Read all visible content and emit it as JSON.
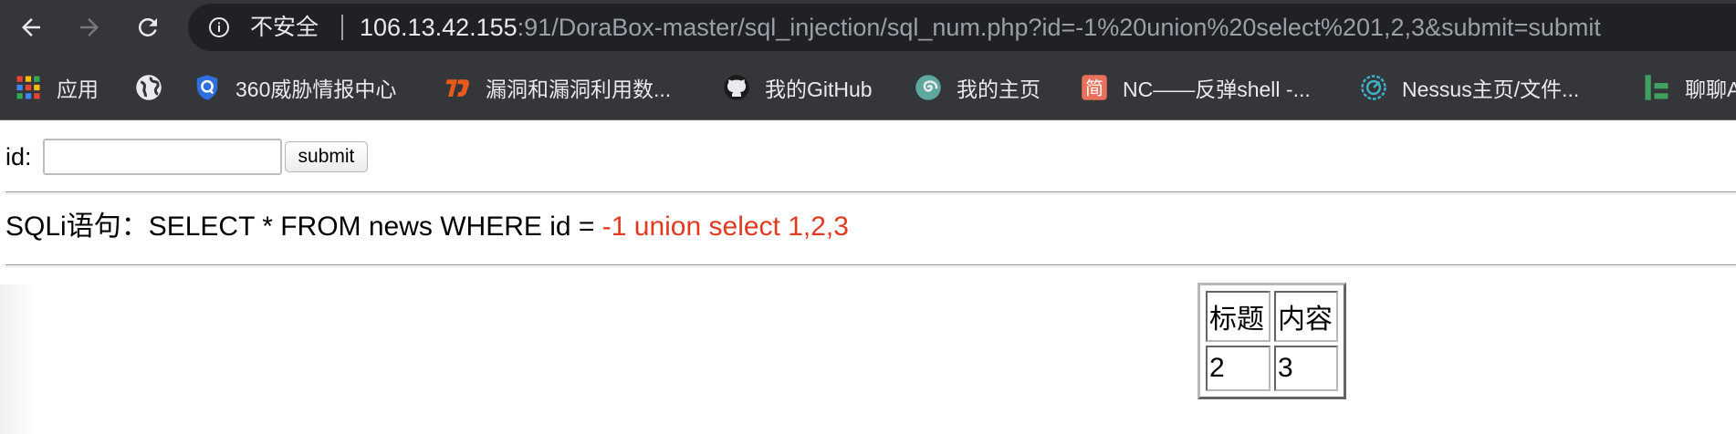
{
  "browser": {
    "back_icon": "arrow-left-icon",
    "forward_icon": "arrow-right-icon",
    "reload_icon": "reload-icon",
    "info_icon": "info-icon",
    "security_label": "不安全",
    "url_host": "106.13.42.155",
    "url_rest": ":91/DoraBox-master/sql_injection/sql_num.php?id=-1%20union%20select%201,2,3&submit=submit"
  },
  "bookmarks": [
    {
      "label": "应用",
      "icon": "apps-grid-icon"
    },
    {
      "label": "",
      "icon": "globe-icon"
    },
    {
      "label": "360威胁情报中心",
      "icon": "360-shield-icon"
    },
    {
      "label": "漏洞和漏洞利用数...",
      "icon": "exploit-db-icon"
    },
    {
      "label": "我的GitHub",
      "icon": "github-icon"
    },
    {
      "label": "我的主页",
      "icon": "spiral-icon"
    },
    {
      "label": "NC——反弹shell -...",
      "icon": "jianshu-icon"
    },
    {
      "label": "Nessus主页/文件...",
      "icon": "nessus-icon"
    },
    {
      "label": "聊聊A",
      "icon": "chat-icon"
    }
  ],
  "form": {
    "id_label": "id:",
    "id_value": "",
    "submit_label": "submit"
  },
  "sqli": {
    "prefix": "SQLi语句：SELECT * FROM news WHERE id = ",
    "value": "-1 union select 1,2,3"
  },
  "result": {
    "headers": [
      "标题",
      "内容"
    ],
    "rows": [
      [
        "2",
        "3"
      ]
    ]
  },
  "colors": {
    "chrome_bg": "#35363a",
    "omnibox_bg": "#202124",
    "sqli_value": "#e03a20"
  }
}
